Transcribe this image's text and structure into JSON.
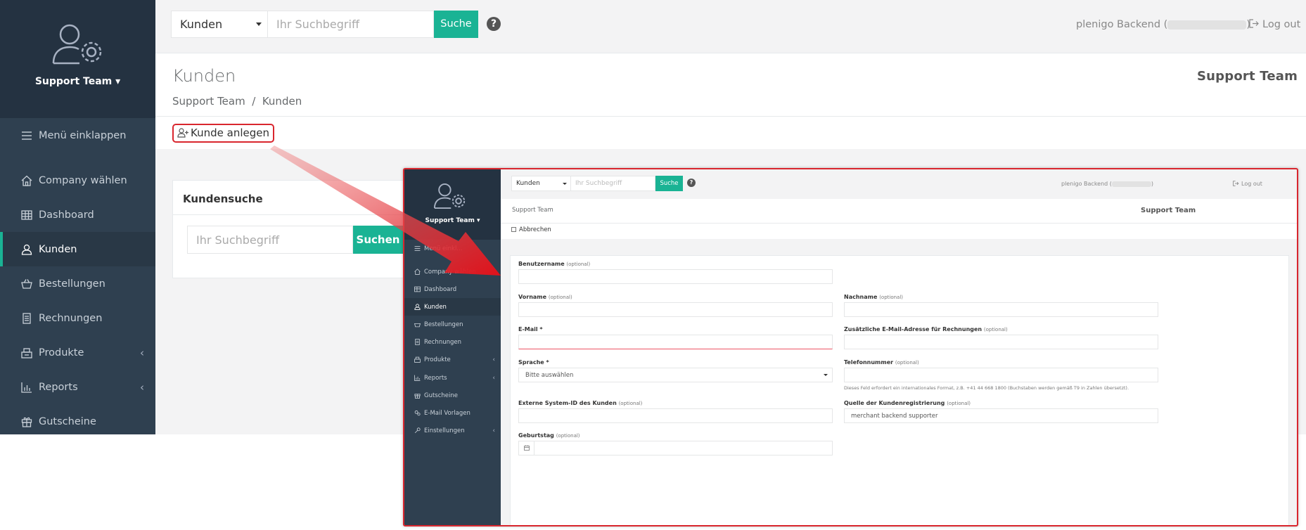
{
  "main": {
    "sidebar": {
      "team": "Support Team",
      "items": [
        {
          "label": "Menü einklappen",
          "icon": "menu-icon"
        },
        {
          "label": "Company wählen",
          "icon": "home-icon"
        },
        {
          "label": "Dashboard",
          "icon": "table-icon"
        },
        {
          "label": "Kunden",
          "icon": "user-icon",
          "active": true
        },
        {
          "label": "Bestellungen",
          "icon": "basket-icon"
        },
        {
          "label": "Rechnungen",
          "icon": "document-icon"
        },
        {
          "label": "Produkte",
          "icon": "products-icon",
          "expandable": true
        },
        {
          "label": "Reports",
          "icon": "bar-chart-icon",
          "expandable": true
        },
        {
          "label": "Gutscheine",
          "icon": "gift-icon"
        }
      ],
      "chevron": "‹"
    },
    "topbar": {
      "select_value": "Kunden",
      "search_placeholder": "Ihr Suchbegriff",
      "search_button": "Suche",
      "help": "?",
      "user_prefix": "plenigo Backend (",
      "user_suffix": ")",
      "logout": "Log out"
    },
    "header": {
      "title": "Kunden",
      "breadcrumb": "Support Team  /  Kunden",
      "brand": "Support Team"
    },
    "actions": {
      "add_customer": "Kunde anlegen"
    },
    "search_card": {
      "title": "Kundensuche",
      "placeholder": "Ihr Suchbegriff",
      "button": "Suchen"
    }
  },
  "inset": {
    "sidebar": {
      "team": "Support Team",
      "items": [
        {
          "label": "Menü einkl...",
          "icon": "menu-icon"
        },
        {
          "label": "Company wählen",
          "icon": "home-icon"
        },
        {
          "label": "Dashboard",
          "icon": "table-icon"
        },
        {
          "label": "Kunden",
          "icon": "user-icon",
          "active": true
        },
        {
          "label": "Bestellungen",
          "icon": "basket-icon"
        },
        {
          "label": "Rechnungen",
          "icon": "document-icon"
        },
        {
          "label": "Produkte",
          "icon": "products-icon",
          "expandable": true
        },
        {
          "label": "Reports",
          "icon": "bar-chart-icon",
          "expandable": true
        },
        {
          "label": "Gutscheine",
          "icon": "gift-icon"
        },
        {
          "label": "E-Mail Vorlagen",
          "icon": "gears-icon"
        },
        {
          "label": "Einstellungen",
          "icon": "wrench-icon",
          "expandable": true
        }
      ],
      "chevron": "‹"
    },
    "topbar": {
      "select_value": "Kunden",
      "search_placeholder": "Ihr Suchbegriff",
      "search_button": "Suche",
      "help": "?",
      "user_prefix": "plenigo Backend (",
      "user_suffix": ")",
      "logout": "Log out"
    },
    "header": {
      "breadcrumb": "Support Team",
      "brand": "Support Team"
    },
    "actions": {
      "cancel": "Abbrechen"
    },
    "form": {
      "optional": "(optional)",
      "username_label": "Benutzername",
      "firstname_label": "Vorname",
      "lastname_label": "Nachname",
      "email_label": "E-Mail *",
      "invoice_email_label": "Zusätzliche E-Mail-Adresse für Rechnungen",
      "language_label": "Sprache *",
      "language_value": "Bitte auswählen",
      "phone_label": "Telefonnummer",
      "phone_hint": "Dieses Feld erfordert ein internationales Format, z.B. +41 44 668 1800 (Buchstaben werden gemäß T9 in Zahlen übersetzt).",
      "external_id_label": "Externe System-ID des Kunden",
      "source_label": "Quelle der Kundenregistrierung",
      "source_value": "merchant backend supporter",
      "birthday_label": "Geburtstag"
    }
  }
}
